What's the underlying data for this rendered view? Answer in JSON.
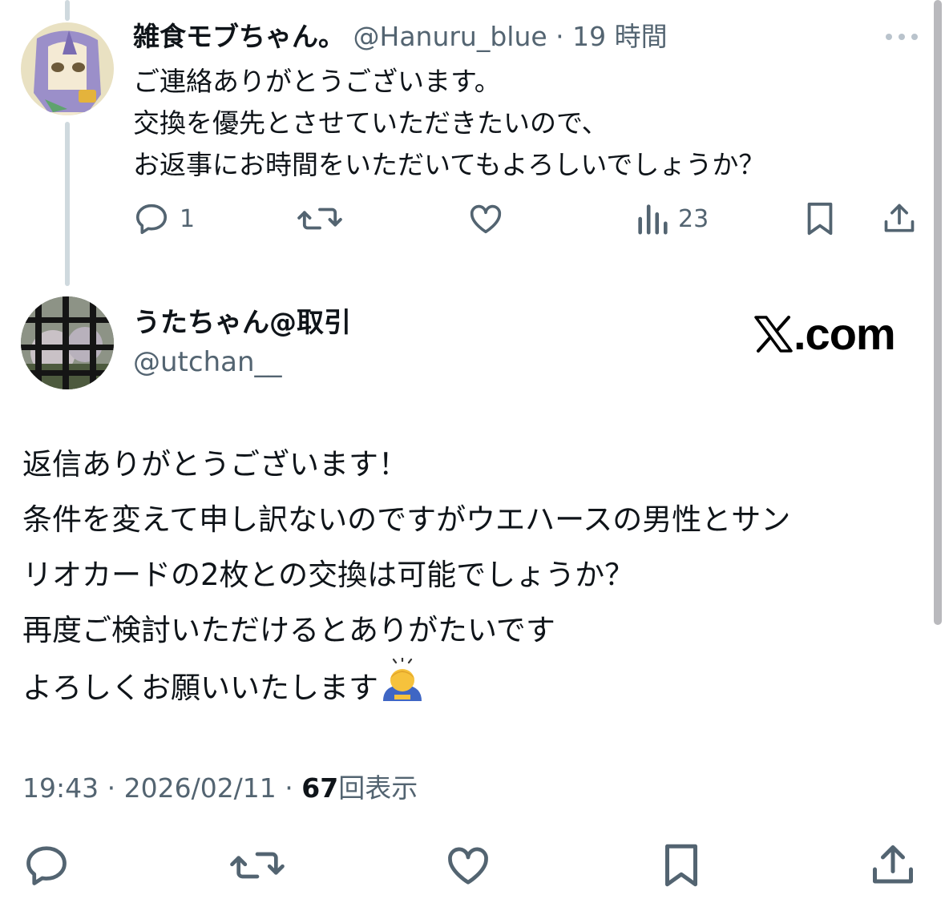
{
  "reply": {
    "display_name": "雑食モブちゃん。",
    "handle": "@Hanuru_blue",
    "separator": " · ",
    "time": "19 時間",
    "lines": [
      "ご連絡ありがとうございます。",
      "交換を優先とさせていただきたいので、",
      "お返事にお時間をいただいてもよろしいでしょうか？"
    ],
    "reply_count": "1",
    "view_count": "23"
  },
  "main": {
    "display_name": "うたちゃん@取引",
    "handle": "@utchan__",
    "brand": ".com",
    "lines": [
      "返信ありがとうございます！",
      "条件を変えて申し訳ないのですがウエハースの男性とサン",
      "リオカードの2枚との交換は可能でしょうか？",
      "再度ご検討いただけるとありがたいです",
      "よろしくお願いいたします"
    ],
    "time": "19:43",
    "date": "2026/02/11",
    "views_count": "67",
    "views_label": "回表示"
  },
  "icons": {
    "reply": "reply-icon",
    "retweet": "retweet-icon",
    "like": "heart-icon",
    "views": "bar-chart-icon",
    "bookmark": "bookmark-icon",
    "share": "share-icon",
    "more": "more-icon",
    "emoji": "person-bowing-icon"
  },
  "colors": {
    "text": "#0f1419",
    "secondary": "#536471",
    "thread_line": "#cfd9de"
  }
}
